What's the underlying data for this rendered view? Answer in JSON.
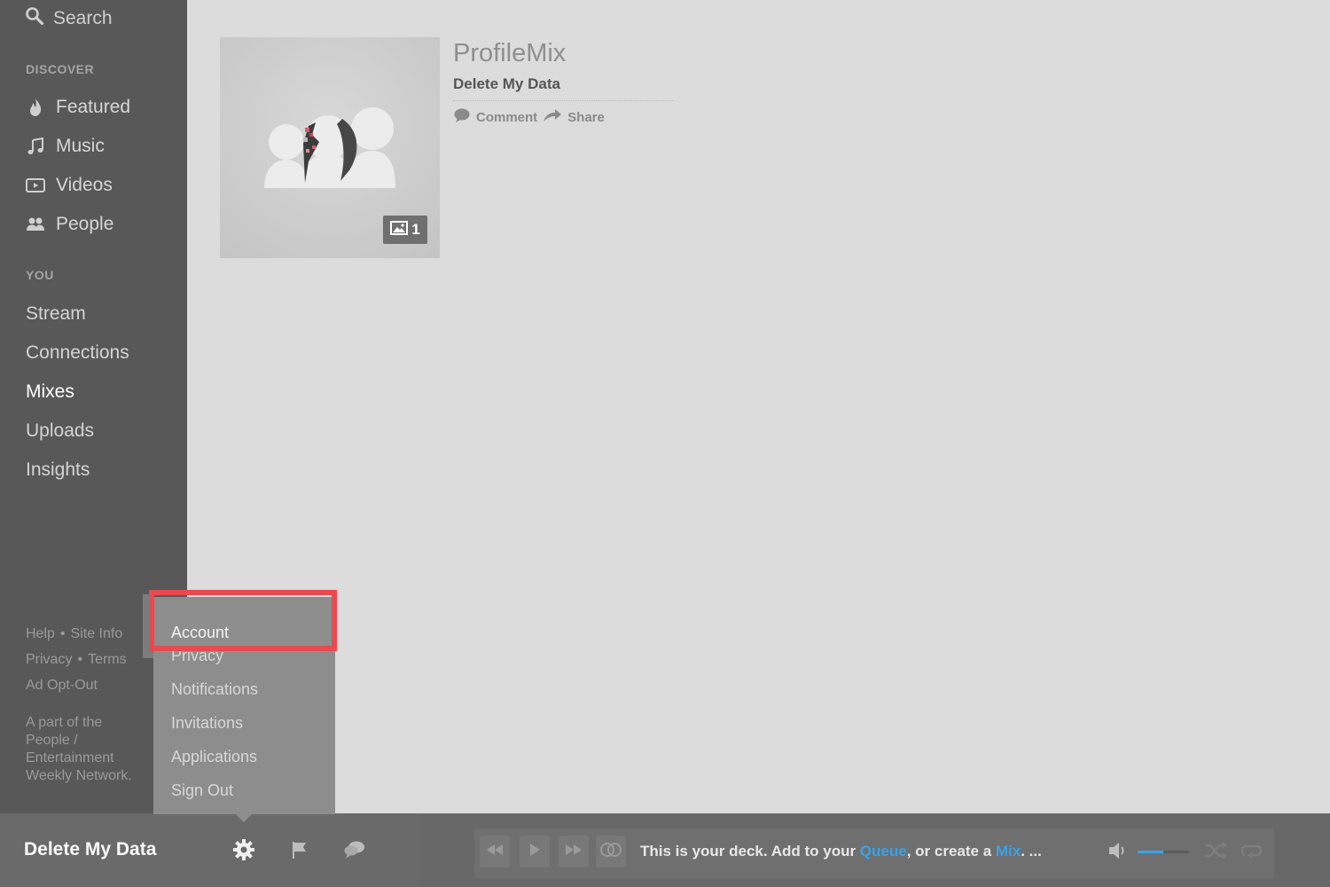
{
  "sidebar": {
    "search_label": "Search",
    "discover": {
      "title": "DISCOVER",
      "items": [
        {
          "label": "Featured",
          "icon": "flame-icon"
        },
        {
          "label": "Music",
          "icon": "music-note-icon"
        },
        {
          "label": "Videos",
          "icon": "video-play-icon"
        },
        {
          "label": "People",
          "icon": "people-icon"
        }
      ]
    },
    "you": {
      "title": "YOU",
      "items": [
        {
          "label": "Stream"
        },
        {
          "label": "Connections"
        },
        {
          "label": "Mixes",
          "active": true
        },
        {
          "label": "Uploads"
        },
        {
          "label": "Insights"
        }
      ]
    },
    "footer": {
      "help": "Help",
      "site_info": "Site Info",
      "privacy": "Privacy",
      "terms": "Terms",
      "ad_opt_out": "Ad Opt-Out",
      "separator": "•",
      "network": "A part of the People / Entertainment Weekly Network."
    }
  },
  "mix": {
    "title": "ProfileMix",
    "subtitle": "Delete My Data",
    "photo_count": "1",
    "actions": {
      "comment": "Comment",
      "share": "Share"
    }
  },
  "settings_menu": {
    "items": [
      "Account",
      "Privacy",
      "Notifications",
      "Invitations",
      "Applications",
      "Sign Out"
    ],
    "highlighted": "Account",
    "highlight_color": "#e84a4f"
  },
  "bottom_bar": {
    "user_name": "Delete My Data",
    "icons": [
      "gear-icon",
      "flag-icon",
      "chat-icon"
    ]
  },
  "deck": {
    "text_before_queue": "This is your deck. Add to your ",
    "queue_link": "Queue",
    "text_middle": ", or create a ",
    "mix_link": "Mix",
    "text_after": ". ...",
    "volume_level": 0.5,
    "link_color": "#3aa3ea"
  }
}
